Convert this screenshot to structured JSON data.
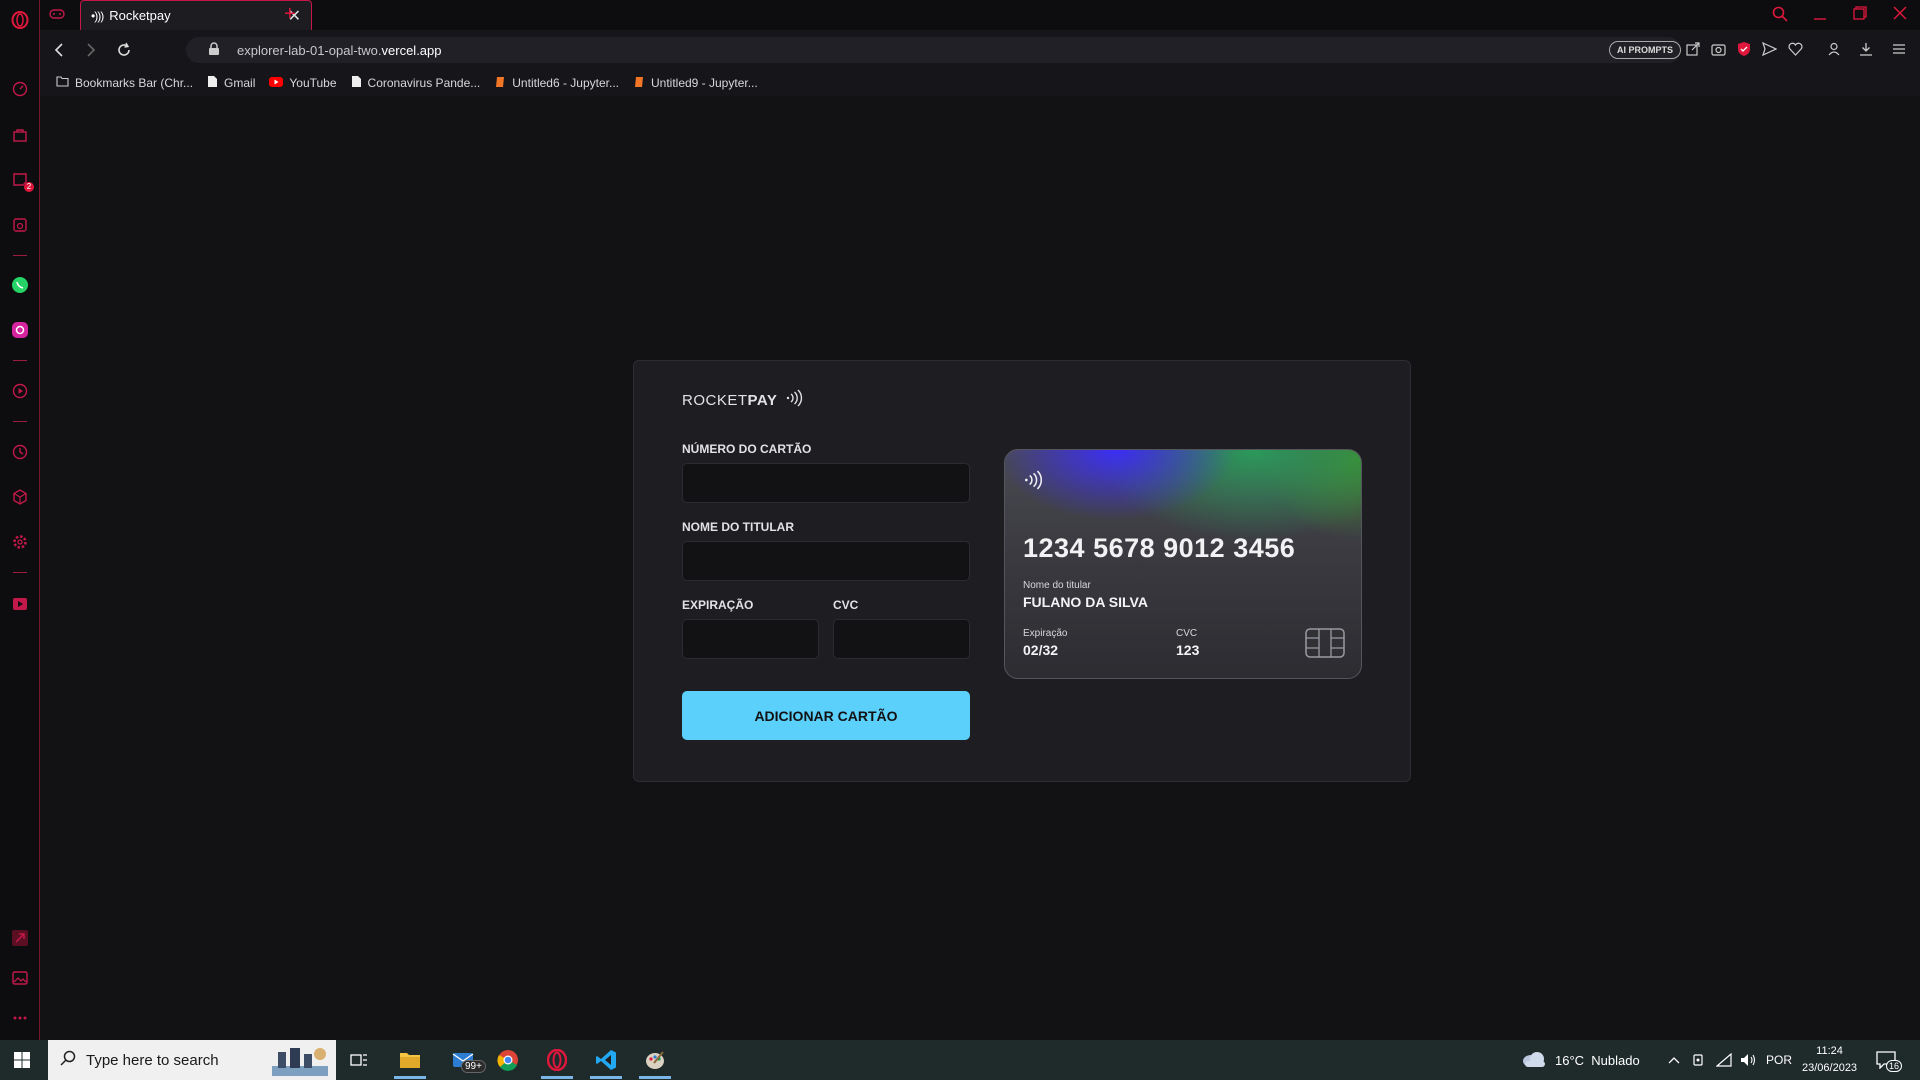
{
  "browser": {
    "tab_title": "Rocketpay",
    "url_domain_prefix": "explorer-lab-01-opal-two.",
    "url_domain_bold": "vercel.app",
    "ai_prompts_label": "AI PROMPTS",
    "sidebar_badge": "2",
    "bookmarks": [
      {
        "label": "Bookmarks Bar (Chr...",
        "icon": "folder-icon"
      },
      {
        "label": "Gmail",
        "icon": "page-icon"
      },
      {
        "label": "YouTube",
        "icon": "youtube-icon"
      },
      {
        "label": "Coronavirus Pande...",
        "icon": "page-icon"
      },
      {
        "label": "Untitled6 - Jupyter...",
        "icon": "jupyter-icon"
      },
      {
        "label": "Untitled9 - Jupyter...",
        "icon": "jupyter-icon"
      }
    ]
  },
  "app": {
    "logo_light": "ROCKET",
    "logo_bold": "PAY",
    "form": {
      "card_number_label": "Número do cartão",
      "holder_label": "Nome do titular",
      "expiration_label": "Expiração",
      "cvc_label": "CVC",
      "card_number_value": "",
      "holder_value": "",
      "expiration_value": "",
      "cvc_value": "",
      "submit_label": "ADICIONAR CARTÃO"
    },
    "card": {
      "number": "1234 5678 9012 3456",
      "holder_caption": "Nome do titular",
      "holder_name": "FULANO DA SILVA",
      "expiration_caption": "Expiração",
      "expiration": "02/32",
      "cvc_caption": "CVC",
      "cvc": "123"
    },
    "colors": {
      "accent": "#5bd0fa",
      "background": "#121214",
      "panel": "#1e1e22"
    }
  },
  "taskbar": {
    "search_placeholder": "Type here to search",
    "mail_badge": "99+",
    "weather": "16°C  Nublado",
    "language": "POR",
    "time": "11:24",
    "date": "23/06/2023",
    "notifications": "16"
  }
}
